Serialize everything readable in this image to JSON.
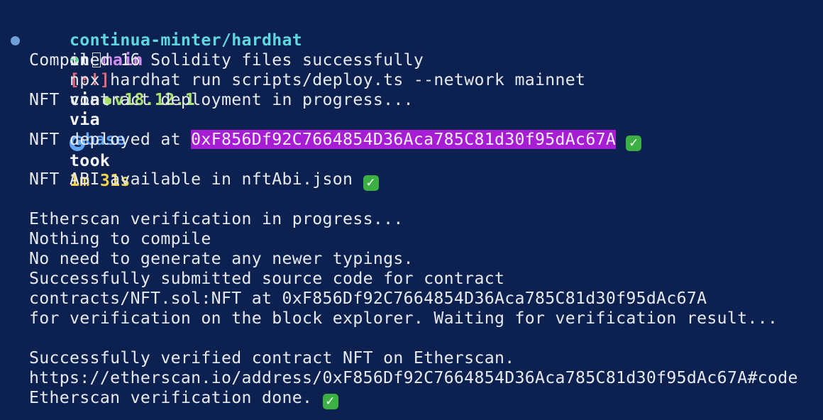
{
  "prompt": {
    "path": "continua-minter/hardhat",
    "on": "on",
    "branch_icon": "git-branch-icon",
    "branch": "main",
    "status": "[⇡!]",
    "via1": "via",
    "node_icon": "node-hexagon-icon",
    "node_version": "v18.12.1",
    "via2": "via",
    "conda_icon": "conda-icon",
    "conda_symbol": "C",
    "conda_env": "base",
    "took": "took",
    "duration": "1m 31s"
  },
  "command": {
    "arrow": "➜",
    "text": "npx hardhat run scripts/deploy.ts --network mainnet"
  },
  "output": {
    "compiled": "Compiled 16 Solidity files successfully",
    "deploy_progress": "NFT contract deployment in progress...",
    "deployed_prefix": "NFT deployed at ",
    "deployed_address": "0xF856Df92C7664854D36Aca785C81d30f95dAc67A",
    "abi": "NFT ABI available in nftAbi.json",
    "verify_progress": "Etherscan verification in progress...",
    "nothing": "Nothing to compile",
    "no_need": "No need to generate any newer typings.",
    "submitted": "Successfully submitted source code for contract",
    "contract_at": "contracts/NFT.sol:NFT at 0xF856Df92C7664854D36Aca785C81d30f95dAc67A",
    "waiting": "for verification on the block explorer. Waiting for verification result...",
    "verified": "Successfully verified contract NFT on Etherscan.",
    "url": "https://etherscan.io/address/0xF856Df92C7664854D36Aca785C81d30f95dAc67A#code",
    "done": "Etherscan verification done.",
    "check_symbol": "✓"
  },
  "colors": {
    "background": "#0d2150",
    "highlight": "#a61dd4",
    "check": "#3cb043"
  }
}
